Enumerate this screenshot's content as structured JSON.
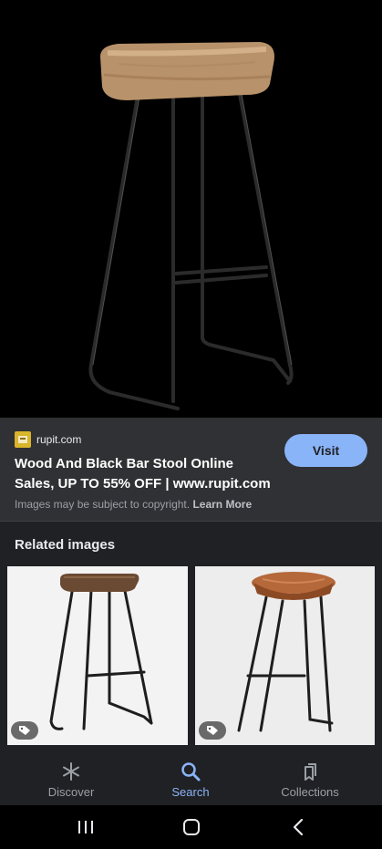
{
  "result": {
    "source_domain": "rupit.com",
    "title": "Wood And Black Bar Stool Online Sales, UP TO 55% OFF | www.rupit.com",
    "visit_label": "Visit",
    "copyright_text": "Images may be subject to copyright.",
    "learn_more_label": "Learn More"
  },
  "related": {
    "heading": "Related images"
  },
  "bottom_nav": {
    "items": [
      {
        "label": "Discover",
        "icon": "asterisk-icon",
        "active": false
      },
      {
        "label": "Search",
        "icon": "search-icon",
        "active": true
      },
      {
        "label": "Collections",
        "icon": "collections-icon",
        "active": false
      }
    ]
  },
  "colors": {
    "accent": "#8ab4f8",
    "panel": "#303134",
    "background": "#202124"
  }
}
